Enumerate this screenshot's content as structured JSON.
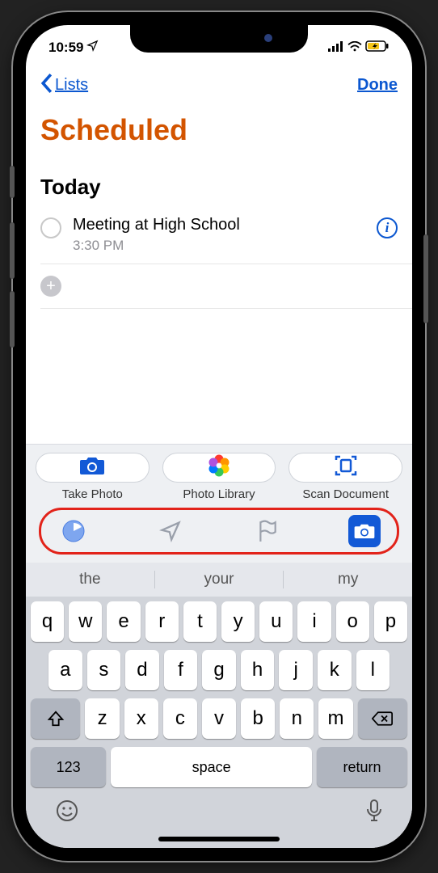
{
  "status": {
    "time": "10:59"
  },
  "nav": {
    "back_label": "Lists",
    "done_label": "Done"
  },
  "title": "Scheduled",
  "section": "Today",
  "reminders": [
    {
      "title": "Meeting at High School",
      "time": "3:30 PM"
    }
  ],
  "attachments": {
    "take_photo": "Take Photo",
    "photo_library": "Photo Library",
    "scan_document": "Scan Document"
  },
  "suggestions": [
    "the",
    "your",
    "my"
  ],
  "keyboard": {
    "row1": [
      "q",
      "w",
      "e",
      "r",
      "t",
      "y",
      "u",
      "i",
      "o",
      "p"
    ],
    "row2": [
      "a",
      "s",
      "d",
      "f",
      "g",
      "h",
      "j",
      "k",
      "l"
    ],
    "row3": [
      "z",
      "x",
      "c",
      "v",
      "b",
      "n",
      "m"
    ],
    "numkey": "123",
    "space": "space",
    "return": "return"
  }
}
